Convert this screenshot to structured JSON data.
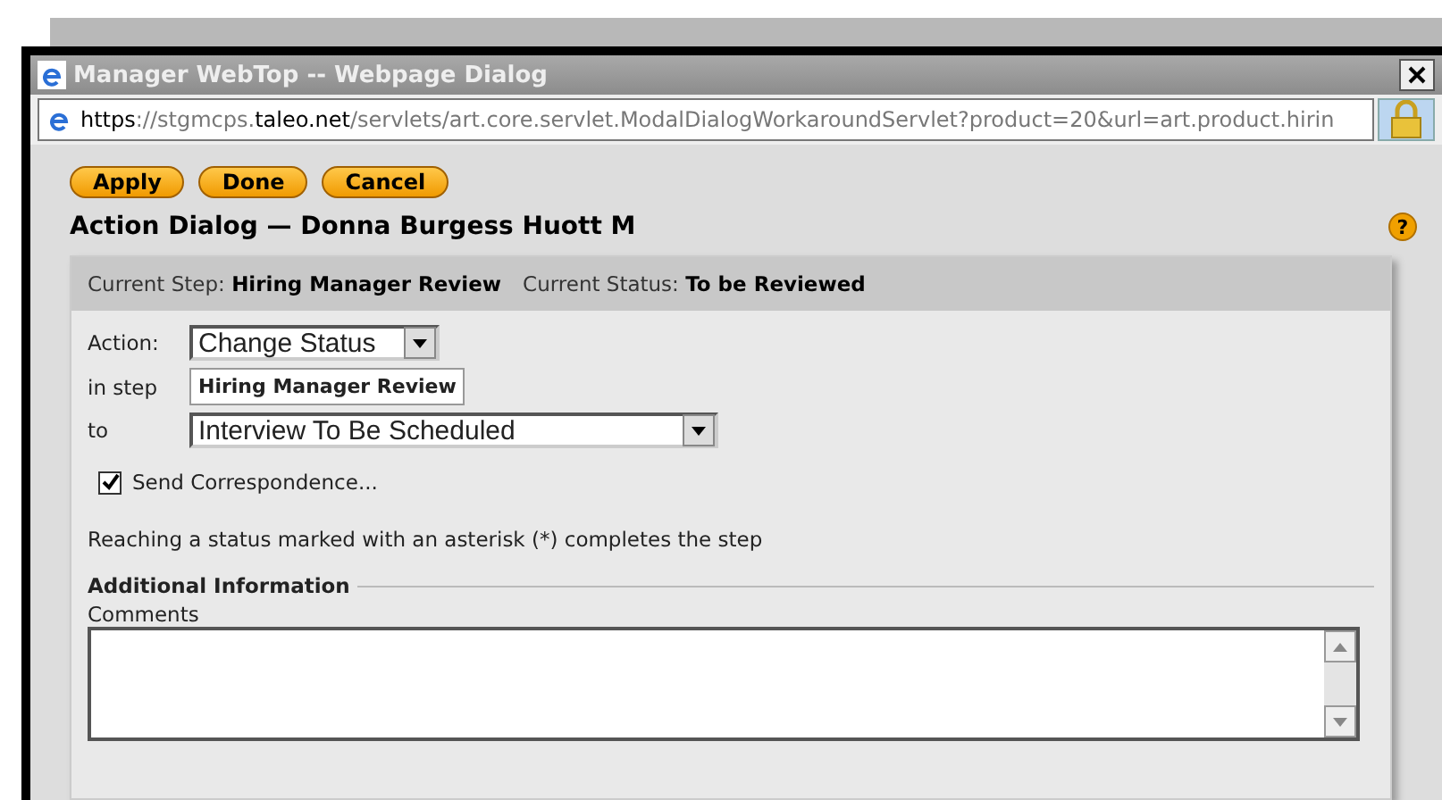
{
  "window": {
    "title": "Manager WebTop -- Webpage Dialog"
  },
  "address_bar": {
    "url_parts": [
      {
        "text": "https",
        "emphasis": true
      },
      {
        "text": "://stgmcps.",
        "emphasis": false
      },
      {
        "text": "taleo.net",
        "emphasis": true
      },
      {
        "text": "/servlets/art.core.servlet.ModalDialogWorkaroundServlet?product=20&url=art.product.hirin",
        "emphasis": false
      }
    ]
  },
  "buttons": [
    "Apply",
    "Done",
    "Cancel"
  ],
  "help_mark": "?",
  "dialog_title": "Action Dialog — Donna Burgess Huott M",
  "status_header": {
    "step_label": "Current Step:",
    "step_value": "Hiring Manager Review",
    "status_label": "Current Status:",
    "status_value": "To be Reviewed"
  },
  "form": {
    "action_label": "Action:",
    "action_value": "Change Status",
    "step_label": "in step",
    "step_value": "Hiring Manager Review",
    "to_label": "to",
    "to_value": "Interview To Be Scheduled"
  },
  "send_correspondence": {
    "label": "Send Correspondence...",
    "checked": true
  },
  "note": "Reaching a status marked with an asterisk (*) completes the step",
  "additional_info": {
    "heading": "Additional Information",
    "comments_label": "Comments"
  }
}
